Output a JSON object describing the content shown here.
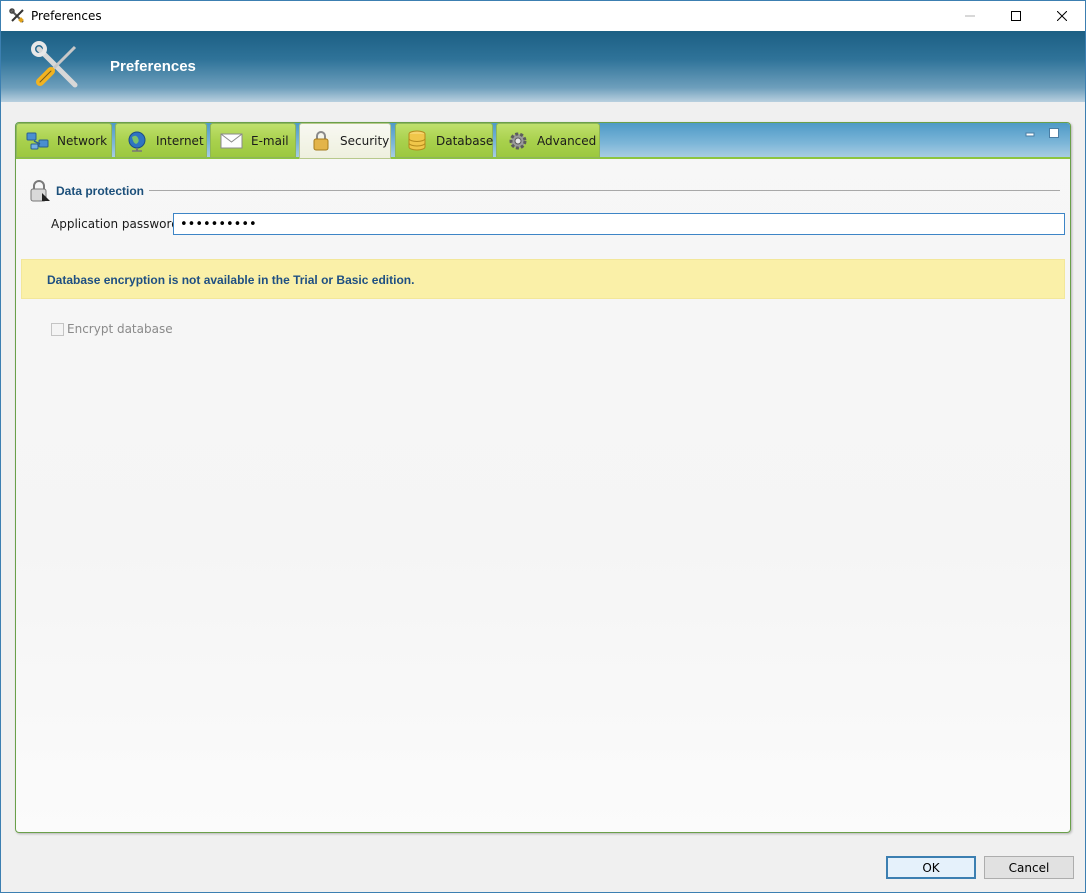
{
  "window": {
    "title": "Preferences",
    "minimize_glyph": "—",
    "maximize_glyph": "☐",
    "close_glyph": "✕"
  },
  "banner": {
    "title": "Preferences",
    "icon": "tools-icon"
  },
  "tabs": [
    {
      "label": "Network",
      "icon": "network-icon",
      "active": false
    },
    {
      "label": "Internet",
      "icon": "globe-icon",
      "active": false
    },
    {
      "label": "E-mail",
      "icon": "envelope-icon",
      "active": false
    },
    {
      "label": "Security",
      "icon": "lock-icon",
      "active": true
    },
    {
      "label": "Database",
      "icon": "database-icon",
      "active": false
    },
    {
      "label": "Advanced",
      "icon": "gear-icon",
      "active": false
    }
  ],
  "security": {
    "section_title": "Data protection",
    "password_label": "Application password:",
    "password_value": "••••••••••",
    "notice": "Database encryption is not available in the Trial or Basic edition.",
    "encrypt_label": "Encrypt database",
    "encrypt_checked": false,
    "encrypt_enabled": false
  },
  "buttons": {
    "ok": "OK",
    "cancel": "Cancel"
  },
  "colors": {
    "tab_green": "#a9d14d",
    "banner_blue": "#2f7399",
    "notice_bg": "#faf0a8",
    "notice_text": "#1e4f82",
    "accent": "#3c7fb1"
  }
}
